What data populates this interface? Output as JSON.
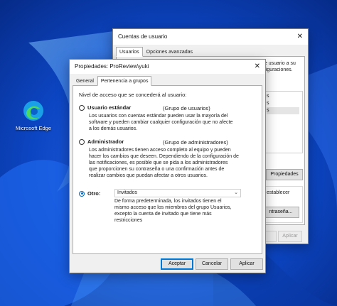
{
  "desktop": {
    "edge_label": "Microsoft Edge"
  },
  "bg_window": {
    "title": "Cuentas de usuario",
    "tabs": [
      {
        "label": "Usuarios"
      },
      {
        "label": "Opciones avanzadas"
      }
    ],
    "text_line1": "de usuario a su",
    "text_line2": "nfiguraciones.",
    "list_items": [
      "s",
      "s",
      "s"
    ],
    "properties_button": "Propiedades",
    "reset_text": "establecer",
    "password_button": "ntraseña...",
    "accept_button": "",
    "apply_button": "Aplicar"
  },
  "dialog": {
    "title": "Propiedades: ProReview\\yuki",
    "close_glyph": "✕",
    "tabs": [
      {
        "label": "General"
      },
      {
        "label": "Pertenencia a grupos"
      }
    ],
    "prompt": "Nivel de acceso que se concederá al usuario:",
    "options": [
      {
        "label": "Usuario estándar",
        "group": "(Grupo de usuarios)",
        "desc": [
          "Los usuarios con cuentas estándar pueden usar la mayoría del",
          "software y pueden cambiar cualquier configuración que no afecte",
          "a los demás usuarios."
        ]
      },
      {
        "label": "Administrador",
        "group": "(Grupo de administradores)",
        "desc": [
          "Los administradores tienen acceso completo al equipo y pueden",
          "hacer los cambios que deseen. Dependiendo de la configuración de",
          "las notificaciones, es posible que se pida a los administradores",
          "que proporcionen su contraseña o una confirmación antes de",
          "realizar cambios que puedan afectar a otros usuarios."
        ]
      },
      {
        "label": "Otro:",
        "select_value": "Invitados",
        "desc": [
          "De forma predeterminada, los invitados tienen el",
          "mismo acceso que los miembros del grupo Usuarios,",
          "excepto la cuenta de invitado que tiene más",
          "restricciones"
        ]
      }
    ],
    "buttons": {
      "accept": "Aceptar",
      "cancel": "Cancelar",
      "apply": "Aplicar"
    }
  },
  "colors": {
    "accent": "#0067c0",
    "wallpaper": "#0b3fb0"
  },
  "icons": [
    "edge-icon",
    "close-icon",
    "chevron-down-icon"
  ]
}
